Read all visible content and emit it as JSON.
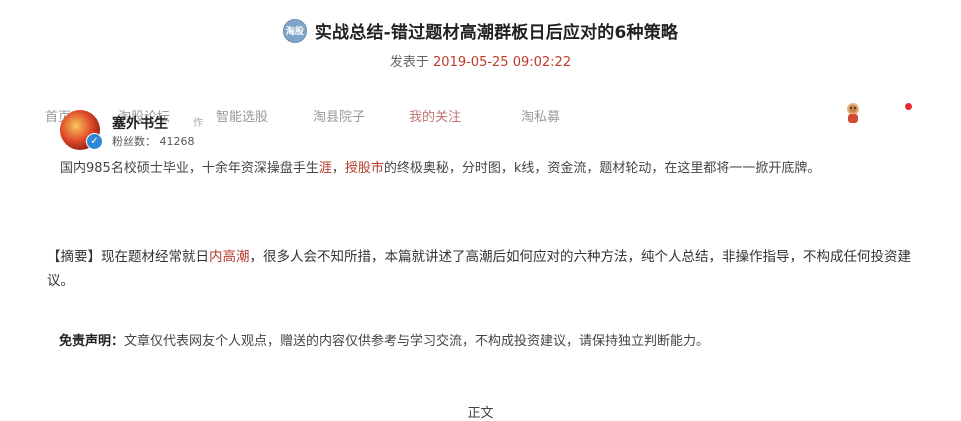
{
  "article": {
    "title_icon": "淘股",
    "title": "实战总结-错过题材高潮群板日后应对的6种策略",
    "date_prefix": "发表于",
    "date": "2019-05-25 09:02:22"
  },
  "nav": {
    "items": [
      "首页",
      "淘股论坛",
      "智能选股",
      "淘县院子",
      "我的关注",
      "淘私募"
    ],
    "sub_fragment": "作",
    "active": "我的关注"
  },
  "author": {
    "name": "塞外书生",
    "fans_label": "粉丝数：",
    "fans_count": "41268",
    "verified_icon": "check-icon"
  },
  "bio": {
    "part1": "国内985名校硕士毕业，十余年资深操盘手生",
    "link1": "涯",
    "part2": "，",
    "link2": "授股市",
    "part3": "的终极奥秘，分时图，k线，资金流，题材轮动，在这里都将一一掀开底牌。"
  },
  "summary": {
    "part1": "【摘要】现在题材经常就日",
    "link": "内高潮",
    "part2": "，很多人会不知所措，本篇就讲述了高潮后如何应对的六种方法，纯个人总结，非操作指导，不构成任何投资建议。"
  },
  "disclaimer": {
    "label": "免责声明：",
    "text": "文章仅代表网友个人观点，赠送的内容仅供参考与学习交流，不构成投资建议，请保持独立判断能力。"
  },
  "body_heading": "正文",
  "colors": {
    "accent_red": "#c0392b",
    "link_red": "#b33a2e",
    "verify_blue": "#2e88d6",
    "notification_dot": "#e8262b"
  }
}
